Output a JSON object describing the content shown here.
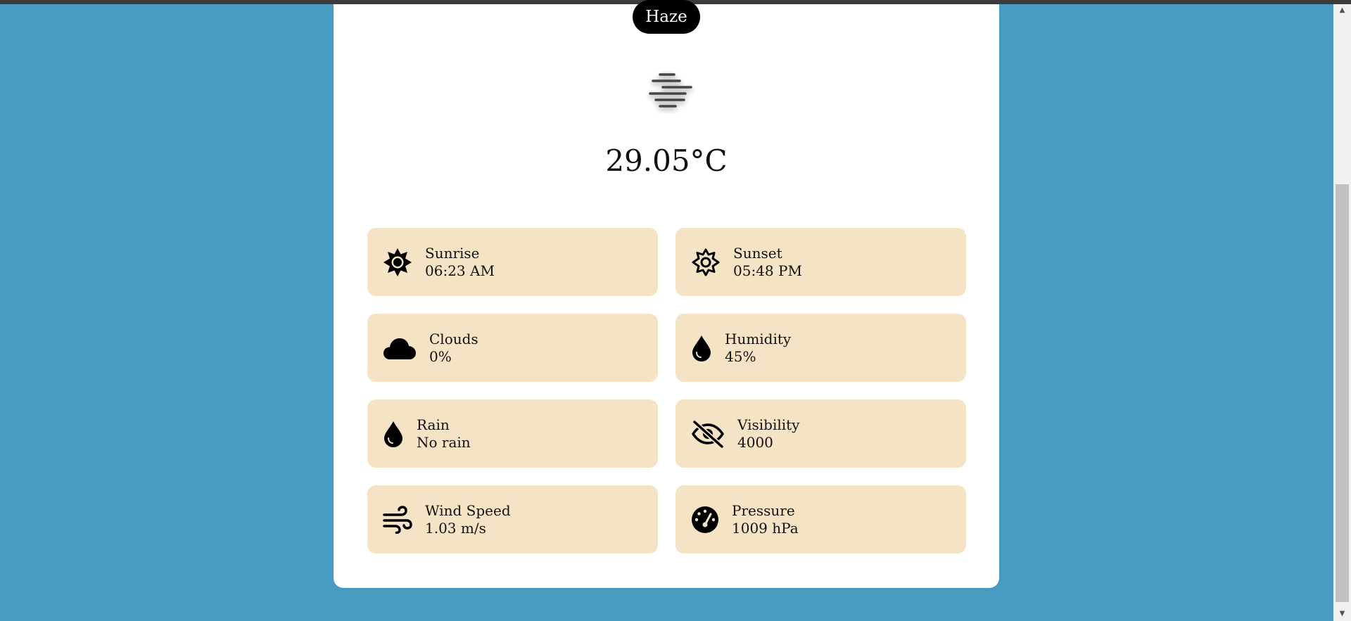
{
  "weather": {
    "condition": "Haze",
    "condition_icon": "haze-icon",
    "temperature": "29.05°C"
  },
  "tiles": [
    {
      "label": "Sunrise",
      "value": "06:23 AM",
      "icon": "sunrise-icon"
    },
    {
      "label": "Sunset",
      "value": "05:48 PM",
      "icon": "sunset-icon"
    },
    {
      "label": "Clouds",
      "value": "0%",
      "icon": "cloud-icon"
    },
    {
      "label": "Humidity",
      "value": "45%",
      "icon": "droplet-icon"
    },
    {
      "label": "Rain",
      "value": "No rain",
      "icon": "droplet-icon"
    },
    {
      "label": "Visibility",
      "value": "4000",
      "icon": "eye-slash-icon"
    },
    {
      "label": "Wind Speed",
      "value": "1.03 m/s",
      "icon": "wind-icon"
    },
    {
      "label": "Pressure",
      "value": "1009 hPa",
      "icon": "gauge-icon"
    }
  ],
  "colors": {
    "background": "#489bc0",
    "card": "#ffffff",
    "tile": "#f4e3c5",
    "badge": "#000000"
  }
}
